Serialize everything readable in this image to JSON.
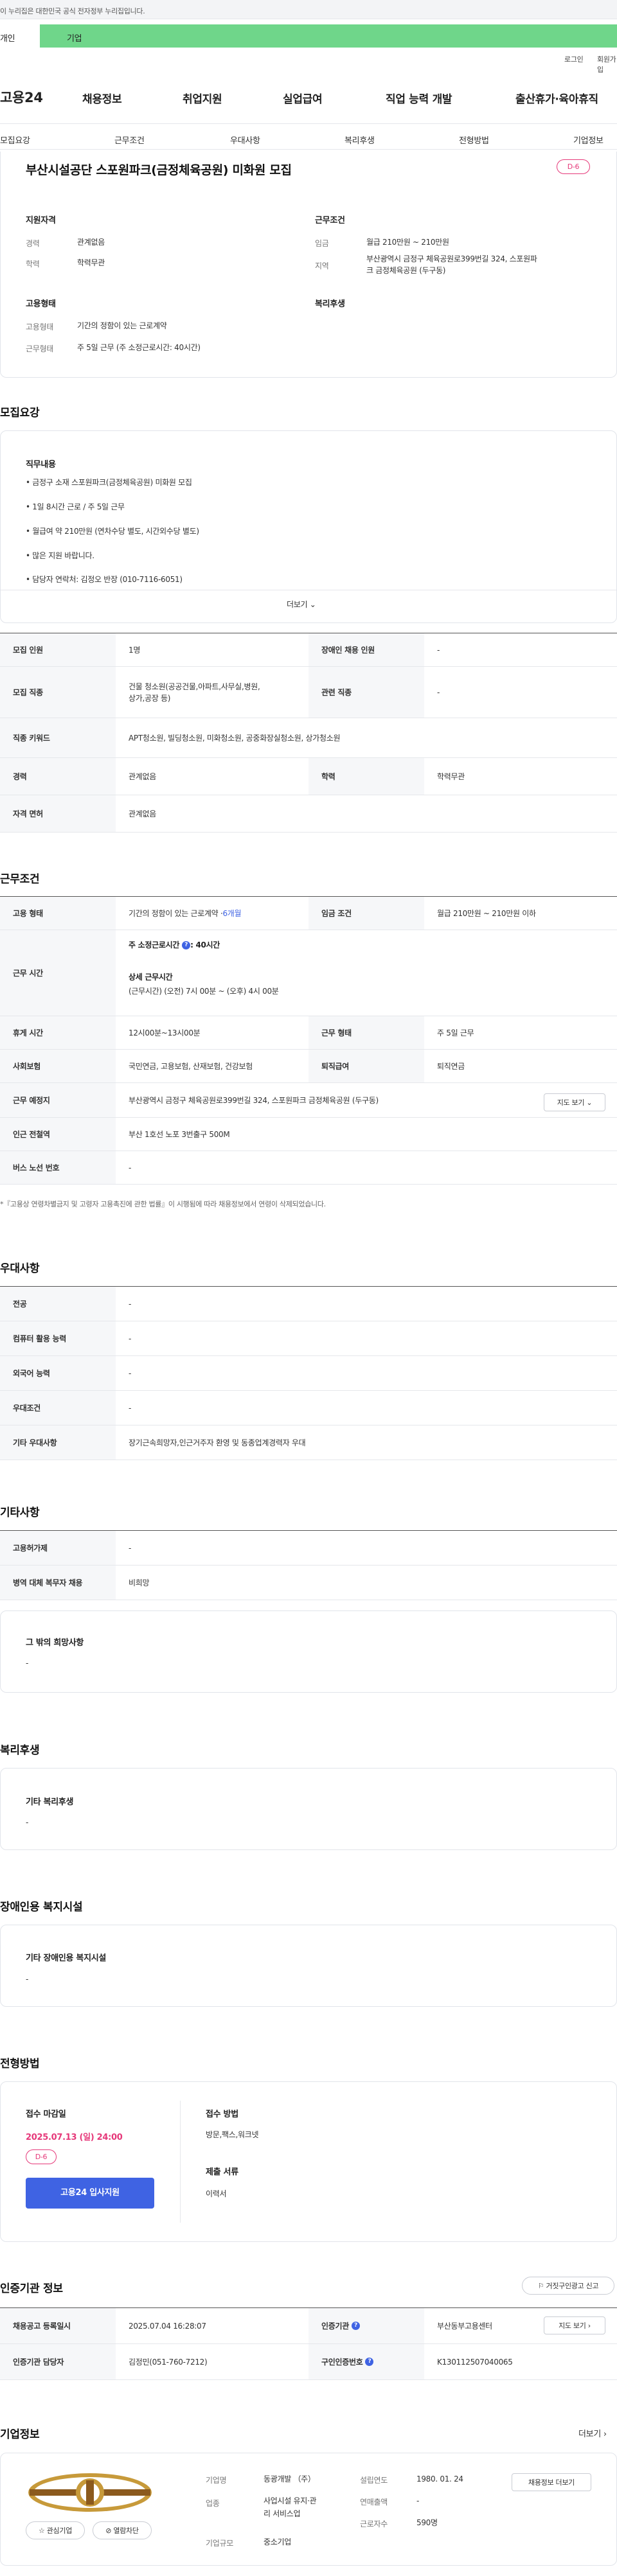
{
  "topbar": {
    "notice": "이 누리집은 대한민국 공식 전자정부 누리집입니다."
  },
  "user_tabs": {
    "individual": "개인",
    "business": "기업"
  },
  "util": {
    "login": "로그인",
    "signup": "회원가입"
  },
  "header": {
    "logo": "고용24",
    "menu": [
      "채용정보",
      "취업지원",
      "실업급여",
      "직업 능력 개발",
      "출산휴가·육아휴직"
    ]
  },
  "subnav": [
    "모집요강",
    "근무조건",
    "우대사항",
    "복리후생",
    "전형방법",
    "기업정보"
  ],
  "summary": {
    "title": "부산시설공단 스포원파크(금정체육공원) 미화원 모집",
    "dday": "D-6",
    "qual_title": "지원자격",
    "career_k": "경력",
    "career_v": "관계없음",
    "edu_k": "학력",
    "edu_v": "학력무관",
    "cond_title": "근무조건",
    "wage_k": "임금",
    "wage_v": "월급 210만원 ~ 210만원",
    "region_k": "지역",
    "region_v1": "부산광역시 금정구 체육공원로399번길 324, 스포원파",
    "region_v2": "크 금정체육공원 (두구동)",
    "emp_title": "고용형태",
    "emptype_k": "고용형태",
    "emptype_v": "기간의 정함이 있는 근로계약",
    "worktype_k": "근무형태",
    "worktype_v": "주 5일 근무 (주 소정근로시간: 40시간)",
    "welfare_title": "복리후생"
  },
  "recruit": {
    "section": "모집요강",
    "duty_title": "직무내용",
    "duty_items": [
      "• 금정구 소재 스포원파크(금정체육공원) 미화원 모집",
      "• 1일 8시간 근로 / 주 5일 근무",
      "• 월급여 약 210만원 (연차수당 별도, 시간외수당 별도)",
      "• 많은 지원 바랍니다.",
      "• 담당자 연락처: 김정오 반장 (010-7116-6051)"
    ],
    "more": "더보기",
    "rows": {
      "headcount_k": "모집 인원",
      "headcount_v": "1명",
      "disabled_k": "장애인 채용 인원",
      "disabled_v": "-",
      "job_k": "모집 직종",
      "job_v1": "건물 청소원(공공건물,아파트,사무실,병원,",
      "job_v2": "상가,공장 등)",
      "related_k": "관련 직종",
      "related_v": "-",
      "kw_k": "직종 키워드",
      "kw_v": "APT청소원, 빌딩청소원, 미화청소원, 공중화장실청소원, 상가청소원",
      "career_k": "경력",
      "career_v": "관계없음",
      "edu_k": "학력",
      "edu_v": "학력무관",
      "license_k": "자격 면허",
      "license_v": "관계없음"
    }
  },
  "conditions": {
    "section": "근무조건",
    "emptype_k": "고용 형태",
    "emptype_v": "기간의 정함이 있는 근로계약 · ",
    "emptype_months": "6개월",
    "wage_k": "임금 조건",
    "wage_v": "월급 210만원 ~ 210만원 이하",
    "hours_k": "근무 시간",
    "hours_week": "주 소정근로시간",
    "hours_week_v": ": 40시간",
    "hours_detail_title": "상세 근무시간",
    "hours_detail_v": "(근무시간) (오전) 7시 00분 ~ (오후) 4시 00분",
    "rest_k": "휴게 시간",
    "rest_v": "12시00분~13시00분",
    "worktype_k": "근무 형태",
    "worktype_v": "주 5일 근무",
    "insurance_k": "사회보험",
    "insurance_v": "국민연금, 고용보험, 산재보험, 건강보험",
    "severance_k": "퇴직급여",
    "severance_v": "퇴직연금",
    "place_k": "근무 예정지",
    "place_v": "부산광역시 금정구 체육공원로399번길 324, 스포원파크 금정체육공원 (두구동)",
    "map_btn": "지도 보기",
    "subway_k": "인근 전철역",
    "subway_v": "부산 1호선 노포 3번출구 500M",
    "bus_k": "버스 노선 번호",
    "bus_v": "-",
    "note": "*『고용상 연령차별금지 및 고령자 고용촉진에 관한 법률』이 시행됨에 따라 채용정보에서 연령이 삭제되었습니다."
  },
  "preference": {
    "section": "우대사항",
    "major_k": "전공",
    "major_v": "-",
    "pc_k": "컴퓨터 활용 능력",
    "pc_v": "-",
    "lang_k": "외국어 능력",
    "lang_v": "-",
    "cond_k": "우대조건",
    "cond_v": "-",
    "other_k": "기타 우대사항",
    "other_v": "장기근속희망자,인근거주자 환영 및 동종업계경력자 우대"
  },
  "etc": {
    "section": "기타사항",
    "permit_k": "고용허가제",
    "permit_v": "-",
    "military_k": "병역 대체 복무자 채용",
    "military_v": "비희망",
    "wish_title": "그 밖의 희망사항",
    "wish_v": "-"
  },
  "welfare": {
    "section": "복리후생",
    "title": "기타 복리후생",
    "v": "-"
  },
  "disabled": {
    "section": "장애인용 복지시설",
    "title": "기타 장애인용 복지시설",
    "v": "-"
  },
  "selection": {
    "section": "전형방법",
    "deadline_title": "접수 마감일",
    "deadline_v": "2025.07.13 (일) 24:00",
    "dday": "D-6",
    "apply_btn": "고용24 입사지원",
    "method_title": "접수 방법",
    "method_v": "방문,팩스,워크넷",
    "docs_title": "제출 서류",
    "docs_v": "이력서"
  },
  "agency": {
    "section": "인증기관 정보",
    "report_btn": "거짓구인광고 신고",
    "reg_k": "채용공고 등록일시",
    "reg_v": "2025.07.04 16:28:07",
    "cert_k": "인증기관",
    "cert_v": "부산동부고용센터",
    "map_btn": "지도 보기",
    "manager_k": "인증기관 담당자",
    "manager_v": "김정민(051-760-7212)",
    "no_k": "구인인증번호",
    "no_v": "K130112507040065"
  },
  "company": {
    "section": "기업정보",
    "more": "더보기",
    "name_k": "기업명",
    "name_v": "동광개발 （주）",
    "industry_k": "업종",
    "industry_v1": "사업시설 유지·관",
    "industry_v2": "리 서비스업",
    "size_k": "기업규모",
    "size_v": "중소기업",
    "founded_k": "설립연도",
    "founded_v": "1980. 01. 24",
    "revenue_k": "연매출액",
    "revenue_v": "-",
    "employees_k": "근로자수",
    "employees_v": "590명",
    "jobs_btn": "채용정보 더보기",
    "fav_btn": "관심기업",
    "block_btn": "열람차단"
  },
  "colors": {
    "accent": "#3f63e3",
    "dday": "#e6397a",
    "biz_tab": "#6fd68a"
  }
}
